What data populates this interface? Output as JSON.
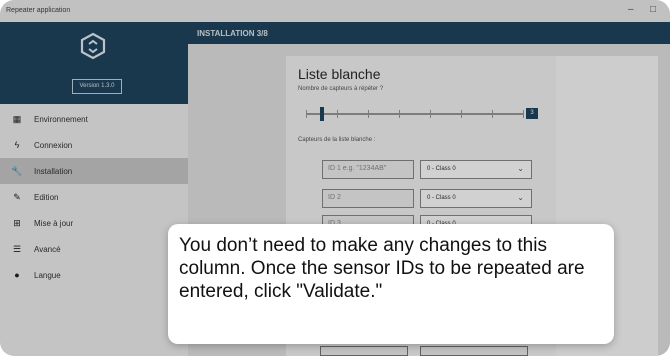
{
  "window": {
    "title": "Repeater application",
    "minimize": "–",
    "maximize": "□"
  },
  "sidebar": {
    "version": "Version 1.3.0",
    "items": [
      {
        "label": "Environnement",
        "icon": "calendar-icon",
        "active": false
      },
      {
        "label": "Connexion",
        "icon": "plug-icon",
        "active": false
      },
      {
        "label": "Installation",
        "icon": "wrench-icon",
        "active": true
      },
      {
        "label": "Edition",
        "icon": "edit-icon",
        "active": false
      },
      {
        "label": "Mise à jour",
        "icon": "update-icon",
        "active": false
      },
      {
        "label": "Avancé",
        "icon": "sliders-icon",
        "active": false
      },
      {
        "label": "Langue",
        "icon": "globe-icon",
        "active": false
      }
    ]
  },
  "content": {
    "header": "INSTALLATION 3/8",
    "heading": "Liste blanche",
    "subtitle": "Nombre de capteurs à répéter ?",
    "slider": {
      "value": "3"
    },
    "sensors_label": "Capteurs de la liste blanche :",
    "sensors": [
      {
        "id_placeholder": "ID 1 e.g. \"1234AB\"",
        "class_value": "0 - Class 0"
      },
      {
        "id_placeholder": "ID 2",
        "class_value": "0 - Class 0"
      },
      {
        "id_placeholder": "ID 3",
        "class_value": "0 - Class 0"
      }
    ]
  },
  "callout": {
    "text": "You don’t need to make any changes to this column. Once the sensor IDs to be repeated are entered, click \"Validate.\""
  },
  "colors": {
    "brand_dark": "#1f4560",
    "active_nav": "#c9c9c9"
  }
}
